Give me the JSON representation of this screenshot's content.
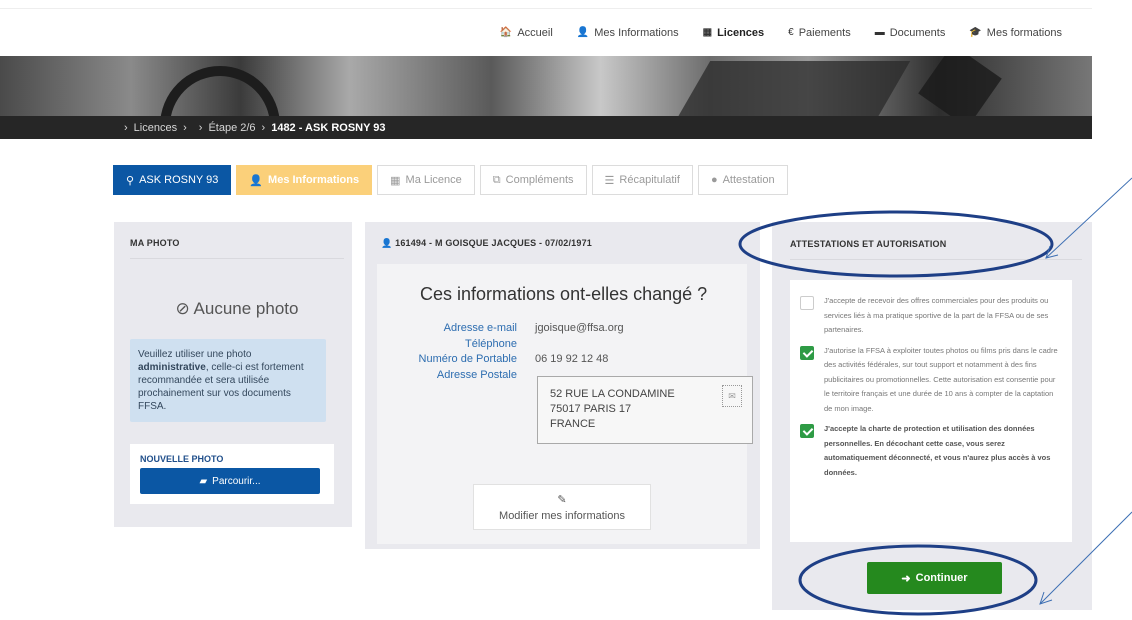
{
  "nav": {
    "items": [
      {
        "icon": "🏠",
        "icon_name": "home-icon",
        "label": "Accueil"
      },
      {
        "icon": "👤",
        "icon_name": "user-icon",
        "label": "Mes Informations"
      },
      {
        "icon": "▦",
        "icon_name": "license-card-icon",
        "label": "Licences",
        "active": true
      },
      {
        "icon": "€",
        "icon_name": "euro-icon",
        "label": "Paiements"
      },
      {
        "icon": "▬",
        "icon_name": "folder-icon",
        "label": "Documents"
      },
      {
        "icon": "🎓",
        "icon_name": "graduation-cap-icon",
        "label": "Mes formations"
      }
    ]
  },
  "breadcrumb": {
    "level1": "Licences",
    "level2": "Étape 2/6",
    "current": "1482 - ASK ROSNY 93"
  },
  "steps": {
    "club": "ASK ROSNY 93",
    "mes_informations": "Mes Informations",
    "ma_licence": "Ma Licence",
    "complements": "Compléments",
    "recapitulatif": "Récapitulatif",
    "attestation": "Attestation"
  },
  "photo": {
    "title": "MA PHOTO",
    "no_photo": "Aucune photo",
    "info_pre": "Veuillez utiliser une photo ",
    "info_bold": "administrative",
    "info_post": ", celle-ci est fortement recommandée et sera utilisée prochainement sur vos documents FFSA.",
    "new_photo_label": "NOUVELLE PHOTO",
    "browse_label": "Parcourir..."
  },
  "person": {
    "title": "161494 - M GOISQUE JACQUES - 07/02/1971",
    "question": "Ces informations ont-elles changé ?",
    "email_label": "Adresse e-mail",
    "email_value": "jgoisque@ffsa.org",
    "phone_label": "Téléphone",
    "phone_value": "",
    "mobile_label": "Numéro de Portable",
    "mobile_value": "06 19 92 12 48",
    "address_label": "Adresse Postale",
    "address_line1": "52 RUE LA CONDAMINE",
    "address_line2": "75017 PARIS 17",
    "address_line3": "FRANCE",
    "modify_label": "Modifier mes informations"
  },
  "attestations": {
    "title": "ATTESTATIONS ET AUTORISATION",
    "items": [
      {
        "checked": false,
        "text": "J'accepte de recevoir des offres commerciales pour des produits ou services liés à ma pratique sportive de la part de la FFSA ou de ses partenaires."
      },
      {
        "checked": true,
        "text": "J'autorise la FFSA à exploiter toutes photos ou films pris dans le cadre des activités fédérales, sur tout support et notamment à des fins publicitaires ou promotionnelles. Cette autorisation est consentie pour le territoire français et une durée de 10 ans à compter de la captation de mon image."
      },
      {
        "checked": true,
        "text": "J'accepte la charte de protection et utilisation des données personnelles. En décochant cette case, vous serez automatiquement déconnecté, et vous n'aurez plus accès à vos données."
      }
    ],
    "continue_label": "Continuer"
  }
}
